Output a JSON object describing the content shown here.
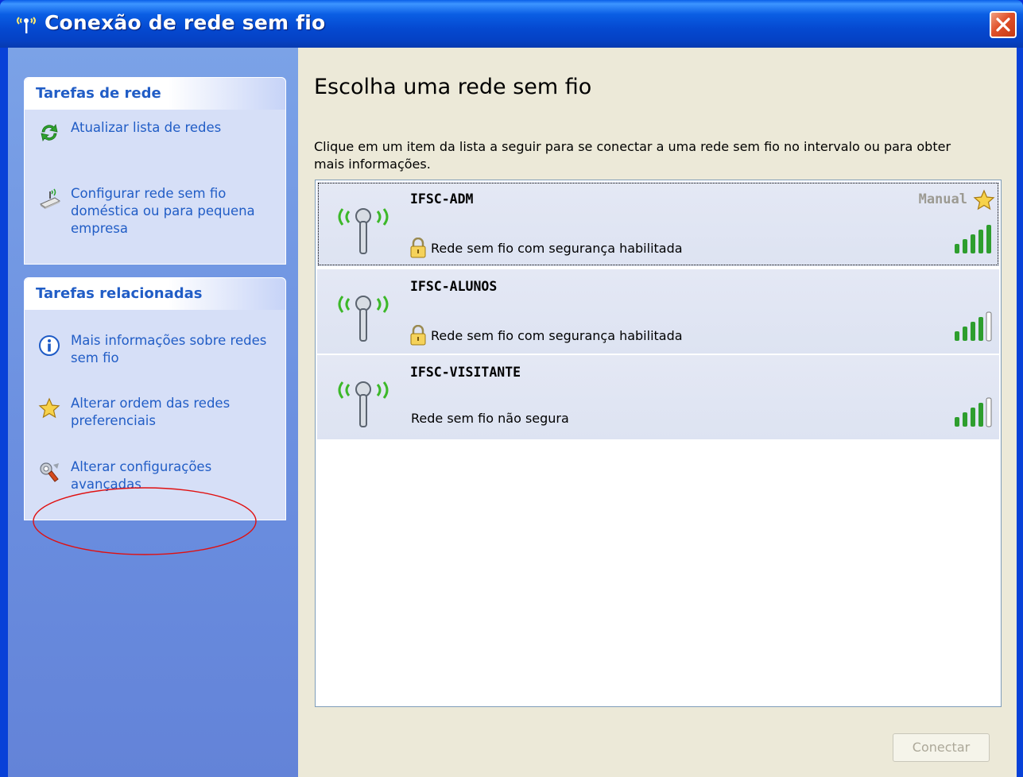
{
  "window": {
    "title": "Conexão de rede sem fio"
  },
  "sidebar": {
    "network_tasks": {
      "header": "Tarefas de rede",
      "items": [
        {
          "label": "Atualizar lista de redes",
          "icon": "refresh-icon"
        },
        {
          "label": "Configurar rede sem fio doméstica ou para pequena empresa",
          "icon": "wireless-setup-icon"
        }
      ]
    },
    "related_tasks": {
      "header": "Tarefas relacionadas",
      "items": [
        {
          "label": "Mais informações sobre redes sem fio",
          "icon": "info-icon"
        },
        {
          "label": "Alterar ordem das redes preferenciais",
          "icon": "star-icon"
        },
        {
          "label": "Alterar configurações avançadas",
          "icon": "settings-tools-icon"
        }
      ]
    }
  },
  "main": {
    "title": "Escolha uma rede sem fio",
    "instructions": "Clique em um item da lista a seguir para se conectar a uma rede sem fio no intervalo ou para obter mais informações.",
    "networks": [
      {
        "name": "IFSC-ADM",
        "status": "Rede sem fio com segurança habilitada",
        "secured": true,
        "manual_label": "Manual",
        "signal_bars": 5
      },
      {
        "name": "IFSC-ALUNOS",
        "status": "Rede sem fio com segurança habilitada",
        "secured": true,
        "signal_bars": 4
      },
      {
        "name": "IFSC-VISITANTE",
        "status": "Rede sem fio não segura",
        "secured": false,
        "signal_bars": 4
      }
    ],
    "connect_label": "Conectar"
  },
  "colors": {
    "titlebar": "#0A5FE8",
    "sidebar_link": "#215DC6",
    "signal_green": "#2E9E2E",
    "annotation_red": "#E01010"
  }
}
